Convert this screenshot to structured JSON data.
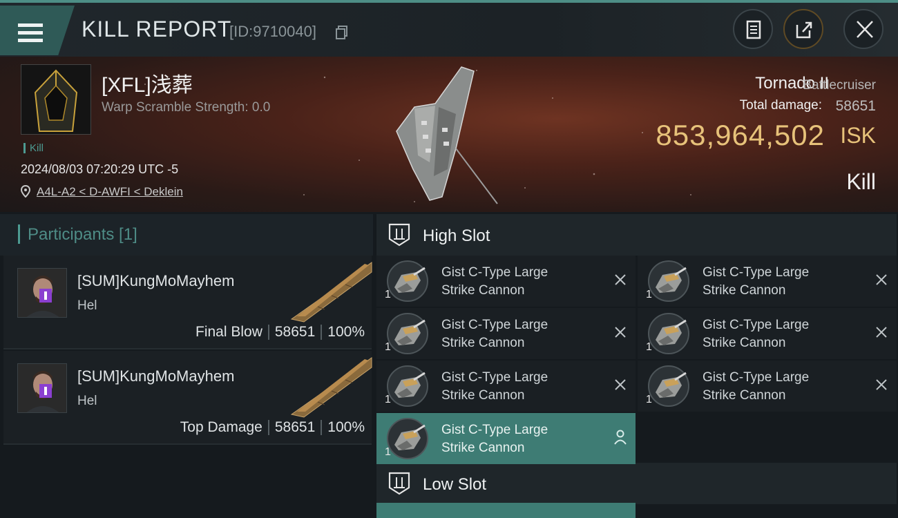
{
  "header": {
    "title": "KILL REPORT",
    "report_id": "[ID:9710040]"
  },
  "victim": {
    "name": "[XFL]浅葬",
    "warp_scramble": "Warp Scramble Strength: 0.0",
    "tag": "Kill",
    "datetime": "2024/08/03 07:20:29 UTC -5",
    "location": "A4L-A2 < D-AWFI < Deklein"
  },
  "ship": {
    "name": "Tornado II",
    "class": "Battlecruiser",
    "damage_label": "Total damage:",
    "damage_value": "58651",
    "isk_value": "853,964,502",
    "isk_unit": "ISK",
    "result": "Kill"
  },
  "participants": {
    "title": "Participants [1]",
    "rows": [
      {
        "name": "[SUM]KungMoMayhem",
        "ship": "Hel",
        "role": "Final Blow",
        "damage": "58651",
        "percent": "100%"
      },
      {
        "name": "[SUM]KungMoMayhem",
        "ship": "Hel",
        "role": "Top Damage",
        "damage": "58651",
        "percent": "100%"
      }
    ]
  },
  "slots": {
    "high": {
      "title": "High Slot",
      "modules": [
        {
          "line1": "Gist C-Type Large",
          "line2": "Strike Cannon",
          "qty": "1",
          "status": "destroyed"
        },
        {
          "line1": "Gist C-Type Large",
          "line2": "Strike Cannon",
          "qty": "1",
          "status": "destroyed"
        },
        {
          "line1": "Gist C-Type Large",
          "line2": "Strike Cannon",
          "qty": "1",
          "status": "destroyed"
        },
        {
          "line1": "Gist C-Type Large",
          "line2": "Strike Cannon",
          "qty": "1",
          "status": "destroyed"
        },
        {
          "line1": "Gist C-Type Large",
          "line2": "Strike Cannon",
          "qty": "1",
          "status": "destroyed"
        },
        {
          "line1": "Gist C-Type Large",
          "line2": "Strike Cannon",
          "qty": "1",
          "status": "destroyed"
        },
        {
          "line1": "Gist C-Type Large",
          "line2": "Strike Cannon",
          "qty": "1",
          "status": "dropped"
        }
      ]
    },
    "low": {
      "title": "Low Slot"
    }
  },
  "icons": [
    "menu-icon",
    "copy-icon",
    "clipboard-icon",
    "share-icon",
    "close-icon",
    "location-pin-icon",
    "high-slot-icon",
    "low-slot-icon",
    "cross-icon",
    "person-icon"
  ],
  "colors": {
    "accent": "#4d9b92",
    "isk": "#e7c27a",
    "active_row": "#3e7c74"
  }
}
